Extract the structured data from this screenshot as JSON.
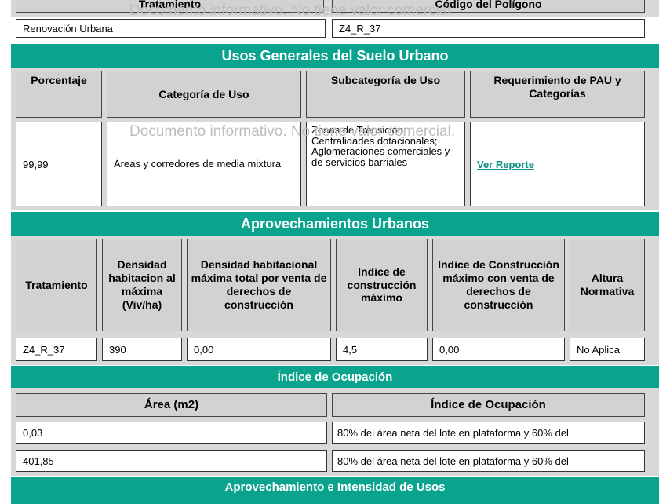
{
  "top_section": {
    "headers": [
      "Tratamiento",
      "Código del Polígono"
    ],
    "row": [
      "Renovación Urbana",
      "Z4_R_37"
    ]
  },
  "watermark": "Documento informativo. No tiene valor comercial.",
  "usos": {
    "title": "Usos Generales del Suelo Urbano",
    "headers": [
      "Porcentaje",
      "Categoría de Uso",
      "Subcategoría de Uso",
      "Requerimiento de PAU y Categorías"
    ],
    "row": {
      "porcentaje": "99,99",
      "categoria": "Áreas y corredores de media mixtura",
      "subcategoria": "Zonas de Transición; Centralidades dotacionales; Aglomeraciones comerciales y de servicios barriales",
      "link": "Ver Reporte"
    }
  },
  "aprovechamientos": {
    "title": "Aprovechamientos Urbanos",
    "headers": [
      "Tratamiento",
      "Densidad habitacion al máxima (Viv/ha)",
      "Densidad habitacional máxima total por venta de derechos de construcción",
      "Indice de construcción máximo",
      "Indice de Construcción máximo con venta de derechos de construcción",
      "Altura Normativa"
    ],
    "row": [
      "Z4_R_37",
      "390",
      "0,00",
      "4,5",
      "0,00",
      "No Aplica"
    ]
  },
  "ocupacion": {
    "title": "Índice de Ocupación",
    "headers": [
      "Área (m2)",
      "Índice de Ocupación"
    ],
    "rows": [
      [
        "0,03",
        "80% del área neta del lote en plataforma y 60% del"
      ],
      [
        "401,85",
        "80% del área neta del lote en plataforma y 60% del"
      ]
    ]
  },
  "intensidad": {
    "title": "Aprovechamiento e Intensidad de Usos"
  },
  "colors": {
    "band": "#0aa48e",
    "header_bg": "#d2d2d2",
    "link": "#0a8f83"
  }
}
